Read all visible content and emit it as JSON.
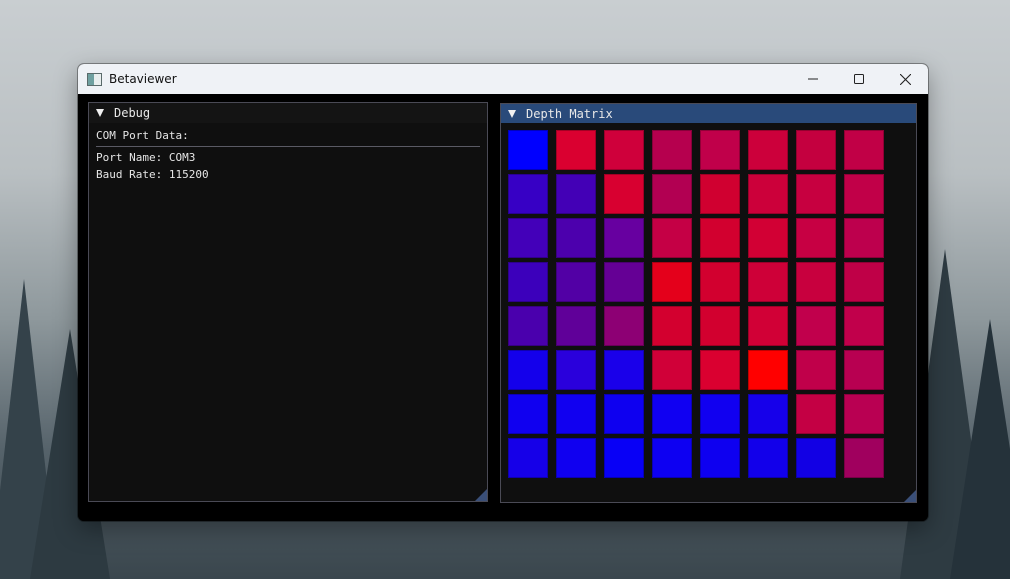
{
  "window": {
    "title": "Betaviewer"
  },
  "title_bar_controls": {
    "minimize_icon": "minimize-icon",
    "maximize_icon": "maximize-icon",
    "close_icon": "close-icon"
  },
  "debug_panel": {
    "header": "Debug",
    "com_port_heading": "COM Port Data:",
    "port_name_line": "Port Name: COM3",
    "baud_rate_line": "Baud Rate: 115200"
  },
  "depth_matrix": {
    "header": "Depth Matrix",
    "rows": 8,
    "cols": 8,
    "colors": [
      [
        "#0000ff",
        "#da0030",
        "#cf003b",
        "#b6004e",
        "#c0004a",
        "#cc003b",
        "#c4003f",
        "#c10046"
      ],
      [
        "#3700c5",
        "#4300b6",
        "#d80030",
        "#b20052",
        "#d00030",
        "#cc003a",
        "#c70040",
        "#c10048"
      ],
      [
        "#4300b9",
        "#4c00ad",
        "#6700a0",
        "#c50045",
        "#d2002f",
        "#d20034",
        "#c70043",
        "#bd004d"
      ],
      [
        "#3c00bb",
        "#5200a5",
        "#650095",
        "#e4001b",
        "#d2002f",
        "#ce0038",
        "#c8003e",
        "#bf0047"
      ],
      [
        "#4a00ad",
        "#600099",
        "#8d0074",
        "#d3002f",
        "#d2002f",
        "#d10036",
        "#c1004c",
        "#c1004b"
      ],
      [
        "#1400eb",
        "#2a00dc",
        "#1a00ea",
        "#d00038",
        "#da0030",
        "#ff0000",
        "#c0004a",
        "#b80051"
      ],
      [
        "#1000f0",
        "#1100f0",
        "#0e00f0",
        "#1000f2",
        "#1100f0",
        "#1600ea",
        "#c40044",
        "#b90052"
      ],
      [
        "#1600e8",
        "#1000f0",
        "#0800f6",
        "#0d00f2",
        "#0e00f0",
        "#1200ea",
        "#1200e4",
        "#a0005e"
      ]
    ]
  }
}
